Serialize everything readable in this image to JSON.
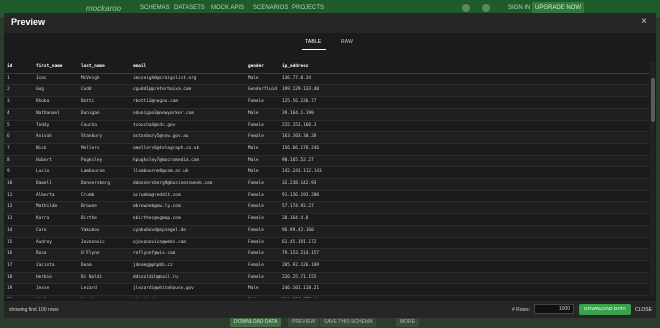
{
  "app": {
    "logo": "mockaroo",
    "nav": [
      "SCHEMAS",
      "DATASETS",
      "MOCK APIS",
      "SCENARIOS",
      "PROJECTS"
    ],
    "sign_in": "SIGN IN",
    "upgrade": "UPGRADE NOW",
    "bottom_buttons": [
      "DOWNLOAD DATA",
      "PREVIEW",
      "SAVE THIS SCHEMA",
      "MORE"
    ]
  },
  "modal": {
    "title": "Preview",
    "tabs": [
      {
        "label": "TABLE",
        "active": true
      },
      {
        "label": "RAW",
        "active": false
      }
    ],
    "columns": [
      "id",
      "first_name",
      "last_name",
      "email",
      "gender",
      "ip_address"
    ],
    "rows": [
      [
        "1",
        "Isac",
        "McVeigh",
        "imcveigh0@craigslist.org",
        "Male",
        "136.77.0.34"
      ],
      [
        "2",
        "Gog",
        "Cudd",
        "cgudd1@preterhaixa.com",
        "Genderfluid",
        "199.129.133.40"
      ],
      [
        "3",
        "Rhoba",
        "Botti",
        "rbotti2@nogou.com",
        "Female",
        "125.56.236.77"
      ],
      [
        "4",
        "Nathanael",
        "Dunigan",
        "ndunigan3@newyorker.com",
        "Male",
        "39.164.1.190"
      ],
      [
        "5",
        "Teddy",
        "Coucha",
        "tcoucha4@cdc.gov",
        "Female",
        "215.152.160.3"
      ],
      [
        "6",
        "Avivah",
        "Stanbury",
        "astanbury5@nsw.gov.au",
        "Female",
        "163.103.30.28"
      ],
      [
        "7",
        "Nick",
        "Mellers",
        "nmellers6@telegraph.co.uk",
        "Male",
        "156.66.178.246"
      ],
      [
        "8",
        "Hubert",
        "Pugksley",
        "hpugksley7@macromedia.com",
        "Male",
        "90.165.52.27"
      ],
      [
        "9",
        "Lucio",
        "Lambourne",
        "llambourne8@cam.ac.uk",
        "Male",
        "142.243.112.143"
      ],
      [
        "10",
        "Dawell",
        "Donnersberg",
        "ddonnersberg9@businessweek.com",
        "Female",
        "32.238.142.93"
      ],
      [
        "11",
        "Alberta",
        "Crumb",
        "acrumba@reddit.com",
        "Female",
        "91.136.193.200"
      ],
      [
        "12",
        "Mathilde",
        "Browne",
        "mbrowneb@ow.ly.com",
        "Female",
        "57.174.92.27"
      ],
      [
        "13",
        "Karra",
        "Birthe",
        "kbirthec@xgmap.com",
        "Female",
        "28.164.4.0"
      ],
      [
        "14",
        "Caro",
        "Yakubov",
        "cyakubovd@spiegel.de",
        "Female",
        "96.99.42.160"
      ],
      [
        "15",
        "Audrey",
        "Jovanovic",
        "ajovanovice@webs.com",
        "Female",
        "61.45.191.172"
      ],
      [
        "16",
        "Rosa",
        "O'Flynn",
        "roflynnf@wix.com",
        "Female",
        "79.153.214.157"
      ],
      [
        "17",
        "Jacinta",
        "Deam",
        "jdeamg@phpbb.cz",
        "Female",
        "205.92.126.109"
      ],
      [
        "18",
        "Herbie",
        "Di Noldi",
        "ddinoldih@mail.ru",
        "Female",
        "226.25.71.155"
      ],
      [
        "19",
        "Jesse",
        "Lezard",
        "jlezardi@whitehouse.gov",
        "Male",
        "246.101.118.21"
      ],
      [
        "20",
        "Kiel",
        "Keedie",
        "kkeediej@wsw.gov.au",
        "Male",
        "204.138.173.4"
      ]
    ],
    "showing_text": "showing first 100 rows",
    "rows_label": "# Rows:",
    "rows_value": "1000",
    "download_label": "DOWNLOAD DATA",
    "close_label": "CLOSE",
    "close_icon": "×"
  },
  "colors": {
    "accent": "#3aa24b",
    "modal_bg": "#1b1b1b",
    "header_bg": "#262626"
  }
}
